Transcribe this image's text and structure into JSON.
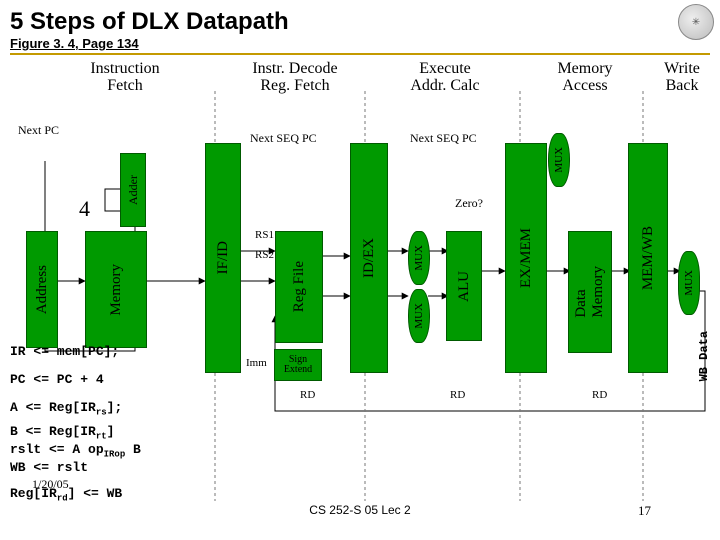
{
  "title": "5 Steps of DLX Datapath",
  "subtitle": "Figure 3. 4, Page 134",
  "stages": {
    "if": "Instruction\nFetch",
    "id": "Instr. Decode\nReg. Fetch",
    "ex": "Execute\nAddr. Calc",
    "mem": "Memory\nAccess",
    "wb": "Write\nBack"
  },
  "labels": {
    "next_pc": "Next PC",
    "next_seq_pc1": "Next SEQ PC",
    "next_seq_pc2": "Next SEQ PC",
    "four": "4",
    "zero": "Zero?",
    "rs1": "RS1",
    "rs2": "RS2",
    "imm": "Imm",
    "rd1": "RD",
    "rd2": "RD",
    "rd3": "RD",
    "wb_data": "WB Data"
  },
  "blocks": {
    "address": "Address",
    "memory_if": "Memory",
    "adder": "Adder",
    "if_id": "IF/ID",
    "reg_file": "Reg File",
    "id_ex": "ID/EX",
    "mux": "MUX",
    "alu": "ALU",
    "ex_mem": "EX/MEM",
    "data_memory": "Data\nMemory",
    "mem_wb": "MEM/WB",
    "sign_extend": "Sign\nExtend"
  },
  "ops": {
    "l1": "IR <= mem[PC];",
    "l2": "PC <= PC + 4",
    "l3_pre": "A <= Reg[IR",
    "l3_sub": "rs",
    "l3_post": "];",
    "l4_pre": "B <= Reg[IR",
    "l4_sub": "rt",
    "l4_post": "]",
    "l5_pre": "rslt <= A op",
    "l5_sub": "IRop",
    "l5_post": " B",
    "l6": "WB <= rslt",
    "l7_pre": "Reg[IR",
    "l7_sub": "rd",
    "l7_post": "] <= WB"
  },
  "footer": {
    "date": "1/20/05",
    "center": "CS 252-S 05 Lec 2",
    "page": "17"
  }
}
